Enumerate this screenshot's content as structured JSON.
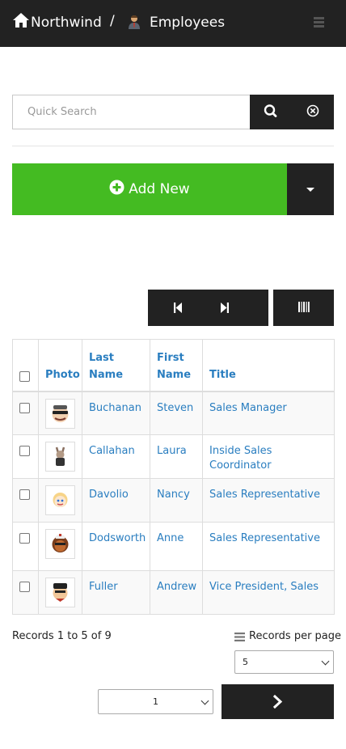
{
  "header": {
    "brand": "Northwind",
    "separator": "/",
    "page_title": "Employees"
  },
  "search": {
    "placeholder": "Quick Search",
    "value": ""
  },
  "actions": {
    "add_new_label": "Add New"
  },
  "table": {
    "columns": [
      "Photo",
      "Last Name",
      "First Name",
      "Title"
    ],
    "rows": [
      {
        "last_name": "Buchanan",
        "first_name": "Steven",
        "title": "Sales Manager"
      },
      {
        "last_name": "Callahan",
        "first_name": "Laura",
        "title": "Inside Sales Coordinator"
      },
      {
        "last_name": "Davolio",
        "first_name": "Nancy",
        "title": "Sales Representative"
      },
      {
        "last_name": "Dodsworth",
        "first_name": "Anne",
        "title": "Sales Representative"
      },
      {
        "last_name": "Fuller",
        "first_name": "Andrew",
        "title": "Vice President, Sales"
      }
    ]
  },
  "footer": {
    "records_info": "Records 1 to 5 of 9",
    "records_per_page_label": "Records per page",
    "records_per_page_value": "5",
    "page_value": "1"
  },
  "colors": {
    "header_bg": "#222222",
    "add_button": "#44bb22",
    "link": "#2a7ec0"
  },
  "icons": [
    "home-icon",
    "employee-icon",
    "menu-icon",
    "search-icon",
    "clear-icon",
    "plus-circle-icon",
    "caret-down-icon",
    "first-page-icon",
    "last-page-icon",
    "columns-icon",
    "list-icon",
    "chevron-right-icon"
  ]
}
